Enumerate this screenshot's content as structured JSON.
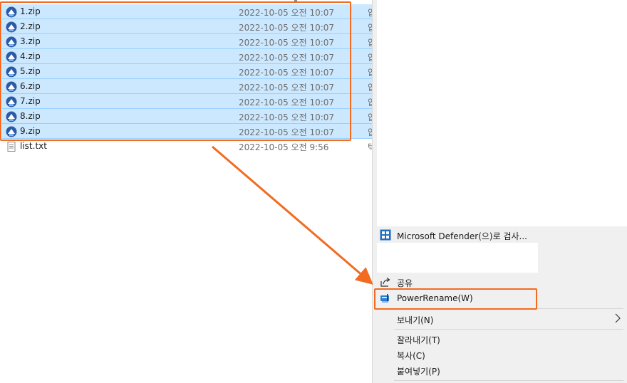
{
  "files": [
    {
      "name": "1.zip",
      "date": "2022-10-05 오전 10:07",
      "type": "압",
      "selected": true,
      "icon": "zip-archive-icon"
    },
    {
      "name": "2.zip",
      "date": "2022-10-05 오전 10:07",
      "type": "압",
      "selected": true,
      "icon": "zip-archive-icon"
    },
    {
      "name": "3.zip",
      "date": "2022-10-05 오전 10:07",
      "type": "압",
      "selected": true,
      "icon": "zip-archive-icon"
    },
    {
      "name": "4.zip",
      "date": "2022-10-05 오전 10:07",
      "type": "압",
      "selected": true,
      "icon": "zip-archive-icon"
    },
    {
      "name": "5.zip",
      "date": "2022-10-05 오전 10:07",
      "type": "압",
      "selected": true,
      "icon": "zip-archive-icon"
    },
    {
      "name": "6.zip",
      "date": "2022-10-05 오전 10:07",
      "type": "압",
      "selected": true,
      "icon": "zip-archive-icon"
    },
    {
      "name": "7.zip",
      "date": "2022-10-05 오전 10:07",
      "type": "압",
      "selected": true,
      "icon": "zip-archive-icon"
    },
    {
      "name": "8.zip",
      "date": "2022-10-05 오전 10:07",
      "type": "압",
      "selected": true,
      "icon": "zip-archive-icon"
    },
    {
      "name": "9.zip",
      "date": "2022-10-05 오전 10:07",
      "type": "압",
      "selected": true,
      "icon": "zip-archive-icon"
    },
    {
      "name": "list.txt",
      "date": "2022-10-05 오전 9:56",
      "type": "텍",
      "selected": false,
      "icon": "text-file-icon"
    }
  ],
  "context_menu": {
    "defender": "Microsoft Defender(으)로 검사...",
    "share": "공유",
    "powerrename": "PowerRename(W)",
    "send_to": "보내기(N)",
    "cut": "잘라내기(T)",
    "copy": "복사(C)",
    "paste": "붙여넣기(P)"
  },
  "colors": {
    "highlight": "#f26b21",
    "selection": "#cce8ff"
  }
}
